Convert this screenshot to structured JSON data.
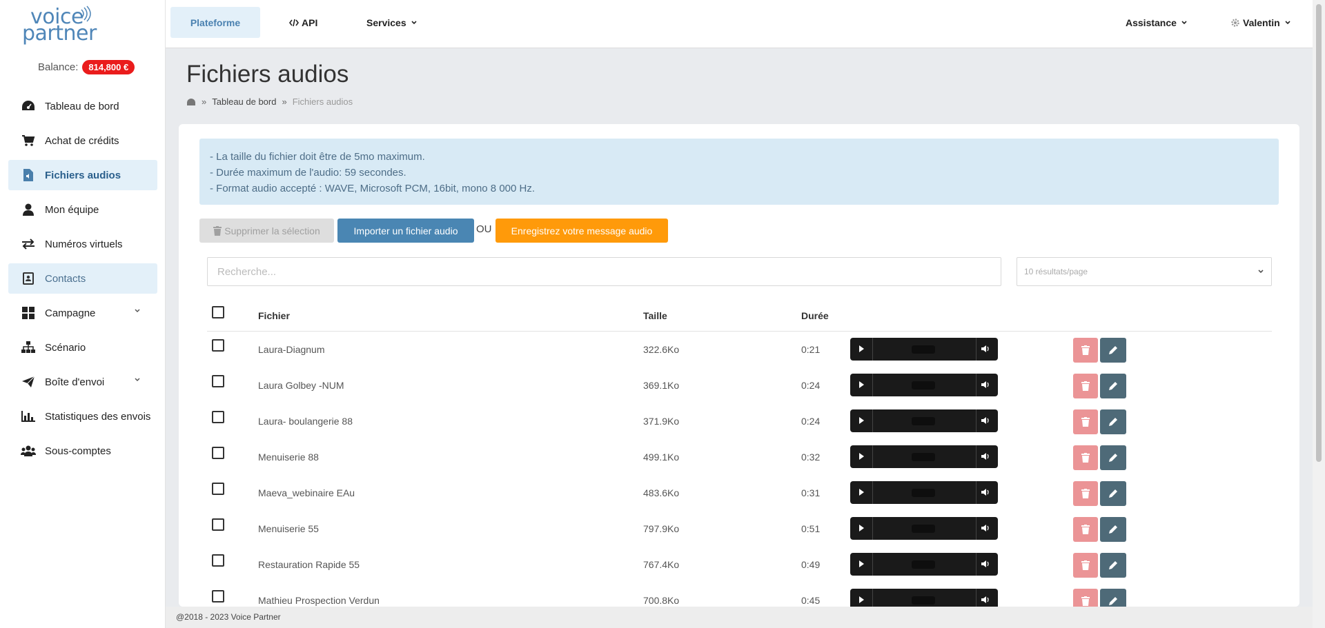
{
  "brand": {
    "line1": "voice",
    "line2": "partner"
  },
  "balance": {
    "label": "Balance:",
    "amount": "814,800 €"
  },
  "sidebar": {
    "items": [
      {
        "label": "Tableau de bord",
        "icon": "dashboard-icon"
      },
      {
        "label": "Achat de crédits",
        "icon": "cart-icon"
      },
      {
        "label": "Fichiers audios",
        "icon": "audio-file-icon"
      },
      {
        "label": "Mon équipe",
        "icon": "user-icon"
      },
      {
        "label": "Numéros virtuels",
        "icon": "exchange-icon"
      },
      {
        "label": "Contacts",
        "icon": "contact-card-icon"
      },
      {
        "label": "Campagne",
        "icon": "grid-icon"
      },
      {
        "label": "Scénario",
        "icon": "sitemap-icon"
      },
      {
        "label": "Boîte d'envoi",
        "icon": "paper-plane-icon"
      },
      {
        "label": "Statistiques des envois",
        "icon": "bar-chart-icon"
      },
      {
        "label": "Sous-comptes",
        "icon": "users-icon"
      }
    ]
  },
  "topbar": {
    "platform": "Plateforme",
    "api": "API",
    "services": "Services",
    "assistance": "Assistance",
    "user": "Valentin"
  },
  "page": {
    "title": "Fichiers audios",
    "breadcrumb": {
      "home": "Tableau de bord",
      "current": "Fichiers audios"
    }
  },
  "info": {
    "line1": "- La taille du fichier doit être de 5mo maximum.",
    "line2": "- Durée maximum de l'audio: 59 secondes.",
    "line3": "- Format audio accepté : WAVE, Microsoft PCM, 16bit, mono 8 000 Hz."
  },
  "actions": {
    "delete_selection": "Supprimer la sélection",
    "import": "Importer un fichier audio",
    "or": "OU",
    "record": "Enregistrez votre message audio"
  },
  "search": {
    "placeholder": "Recherche..."
  },
  "perpage": {
    "selected": "10 résultats/page"
  },
  "table": {
    "headers": {
      "file": "Fichier",
      "size": "Taille",
      "duration": "Durée"
    },
    "rows": [
      {
        "name": "Laura-Diagnum",
        "size": "322.6Ko",
        "duration": "0:21"
      },
      {
        "name": "Laura Golbey -NUM",
        "size": "369.1Ko",
        "duration": "0:24"
      },
      {
        "name": "Laura- boulangerie 88",
        "size": "371.9Ko",
        "duration": "0:24"
      },
      {
        "name": "Menuiserie 88",
        "size": "499.1Ko",
        "duration": "0:32"
      },
      {
        "name": "Maeva_webinaire EAu",
        "size": "483.6Ko",
        "duration": "0:31"
      },
      {
        "name": "Menuiserie 55",
        "size": "797.9Ko",
        "duration": "0:51"
      },
      {
        "name": "Restauration Rapide 55",
        "size": "767.4Ko",
        "duration": "0:49"
      },
      {
        "name": "Mathieu Prospection Verdun",
        "size": "700.8Ko",
        "duration": "0:45"
      }
    ]
  },
  "footer": {
    "text": "@2018 - 2023 Voice Partner"
  },
  "colors": {
    "accent": "#4a86b3",
    "badge": "#ea1c1c",
    "record": "#ff9a0a",
    "delete": "#eb9496",
    "edit": "#4e6a78"
  }
}
